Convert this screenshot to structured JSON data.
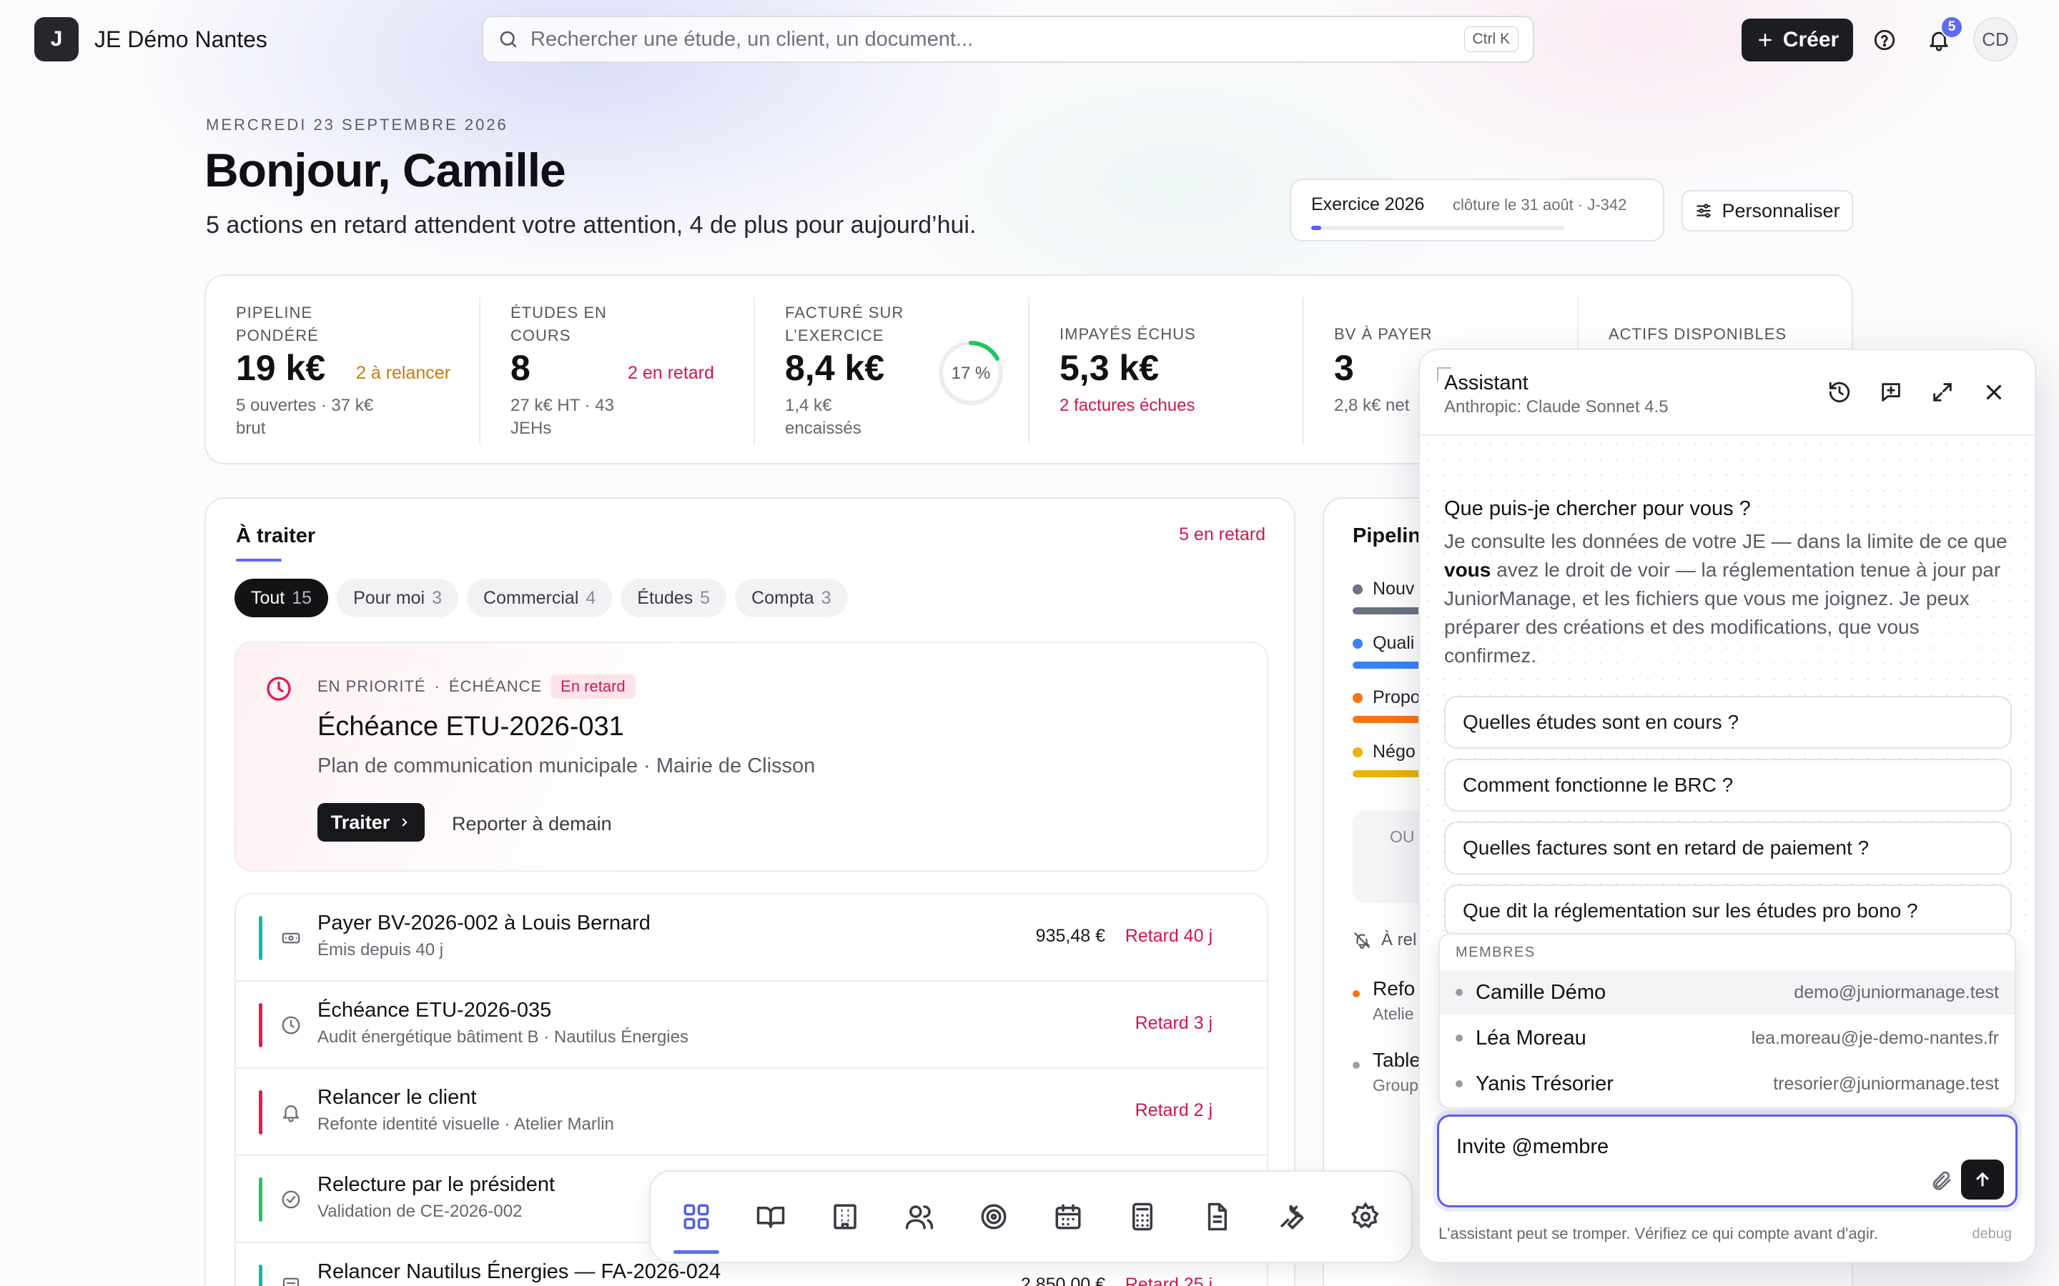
{
  "topbar": {
    "logo_letter": "J",
    "app_name": "JE Démo Nantes",
    "search_placeholder": "Rechercher une étude, un client, un document...",
    "search_shortcut": "Ctrl K",
    "create_label": "Créer",
    "notifications_count": "5",
    "avatar_initials": "CD"
  },
  "header": {
    "date": "MERCREDI 23 SEPTEMBRE 2026",
    "greeting": "Bonjour, Camille",
    "subtitle": "5 actions en retard attendent votre attention, 4 de plus pour aujourd’hui.",
    "exercise_label": "Exercice 2026",
    "exercise_closing": "clôture le 31 août · J-342",
    "exercise_progress": 0.04,
    "customize_label": "Personnaliser"
  },
  "kpis": [
    {
      "label": "PIPELINE PONDÉRÉ",
      "value": "19 k€",
      "side": "2 à relancer",
      "side_color": "#c97a0a",
      "sub": "5 ouvertes · 37 k€ brut"
    },
    {
      "label": "ÉTUDES EN COURS",
      "value": "8",
      "side": "2 en retard",
      "side_color": "#d2174a",
      "sub": "27 k€ HT · 43 JEHs"
    },
    {
      "label": "FACTURÉ SUR L’EXERCICE",
      "value": "8,4 k€",
      "ring_label": "17 %",
      "ring_fraction": 0.17,
      "sub": "1,4 k€ encaissés"
    },
    {
      "label": "IMPAYÉS ÉCHUS",
      "value": "5,3 k€",
      "sub": "2 factures échues",
      "sub_color": "#d2174a"
    },
    {
      "label": "BV À PAYER",
      "value": "3",
      "sub": "2,8 k€ net"
    },
    {
      "label": "ACTIFS DISPONIBLES"
    }
  ],
  "todo": {
    "title": "À traiter",
    "late_count": "5 en retard",
    "filters": [
      {
        "label": "Tout",
        "count": "15"
      },
      {
        "label": "Pour moi",
        "count": "3"
      },
      {
        "label": "Commercial",
        "count": "4"
      },
      {
        "label": "Études",
        "count": "5"
      },
      {
        "label": "Compta",
        "count": "3"
      }
    ],
    "priority": {
      "tag1": "EN PRIORITÉ",
      "tag2": "ÉCHÉANCE",
      "status": "En retard",
      "title": "Échéance ETU-2026-031",
      "subtitle": "Plan de communication municipale · Mairie de Clisson",
      "action": "Traiter",
      "postpone": "Reporter à demain"
    },
    "tasks": [
      {
        "title": "Payer BV-2026-002 à Louis Bernard",
        "sub": "Émis depuis 40 j",
        "amount": "935,48 €",
        "delay": "Retard 40 j",
        "color": "#14b8a6",
        "icon": "payment-icon"
      },
      {
        "title": "Échéance ETU-2026-035",
        "sub": "Audit énergétique bâtiment B · Nautilus Énergies",
        "amount": "",
        "delay": "Retard 3 j",
        "color": "#e11d48",
        "icon": "clock-icon"
      },
      {
        "title": "Relancer le client",
        "sub": "Refonte identité visuelle · Atelier Marlin",
        "amount": "",
        "delay": "Retard 2 j",
        "color": "#e11d48",
        "icon": "bell-icon"
      },
      {
        "title": "Relecture par le président",
        "sub": "Validation de CE-2026-002",
        "amount": "",
        "delay": "",
        "color": "#22c55e",
        "icon": "check-circle-icon"
      },
      {
        "title": "Relancer Nautilus Énergies — FA-2026-024",
        "sub": "",
        "amount": "2 850,00 €",
        "delay": "Retard 25 j",
        "color": "#14b8a6",
        "icon": "invoice-icon"
      }
    ]
  },
  "pipeline": {
    "title": "Pipeline",
    "stages": [
      {
        "label": "Nouv",
        "color": "#6b7280"
      },
      {
        "label": "Quali",
        "color": "#3b82f6"
      },
      {
        "label": "Propo",
        "color": "#f97316"
      },
      {
        "label": "Négo",
        "color": "#eab308"
      }
    ],
    "box_text": "OU",
    "reminder_label": "À rel",
    "items": [
      {
        "title": "Refo",
        "sub": "Atelie",
        "color": "#f97316"
      },
      {
        "title": "Table",
        "sub": "Group",
        "color": "#9ca3af"
      }
    ]
  },
  "dock": {
    "items": [
      "dashboard-icon",
      "book-icon",
      "building-icon",
      "users-icon",
      "target-icon",
      "calendar-icon",
      "calculator-icon",
      "document-icon",
      "wrench-icon",
      "settings-icon"
    ]
  },
  "assistant": {
    "title": "Assistant",
    "model": "Anthropic: Claude Sonnet 4.5",
    "question": "Que puis-je chercher pour vous ?",
    "intro_before": "Je consulte les données de votre JE — dans la limite de ce que ",
    "intro_bold": "vous",
    "intro_after": " avez le droit de voir — la réglementation tenue à jour par JuniorManage, et les fichiers que vous me joignez. Je peux préparer des créations et des modifications, que vous confirmez.",
    "suggestions": [
      "Quelles études sont en cours ?",
      "Comment fonctionne le BRC ?",
      "Quelles factures sont en retard de paiement ?",
      "Que dit la réglementation sur les études pro bono ?"
    ],
    "mention_header": "MEMBRES",
    "members": [
      {
        "name": "Camille Démo",
        "email": "demo@juniormanage.test"
      },
      {
        "name": "Léa Moreau",
        "email": "lea.moreau@je-demo-nantes.fr"
      },
      {
        "name": "Yanis Trésorier",
        "email": "tresorier@juniormanage.test"
      }
    ],
    "input_value": "Invite @membre",
    "disclaimer": "L'assistant peut se tromper. Vérifiez ce qui compte avant d'agir.",
    "debug_label": "debug"
  }
}
